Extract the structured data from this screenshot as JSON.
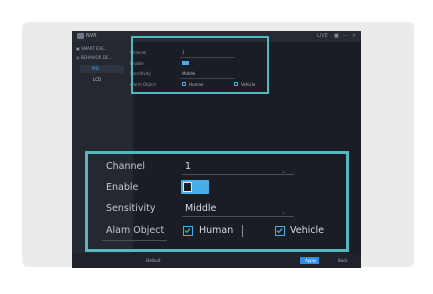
{
  "app": {
    "title": "NVR",
    "window_buttons": [
      "LIVE",
      "■",
      "—",
      "✕"
    ]
  },
  "sidebar": {
    "items": [
      {
        "label": "SMART EVE...",
        "icon": "camera-icon"
      },
      {
        "label": "BEHAVIOR DE...",
        "icon": "person-icon"
      }
    ],
    "selected_label": "PID",
    "sub_label": "LCD"
  },
  "small_form": {
    "channel_label": "Channel",
    "channel_value": "1",
    "enable_label": "Enable",
    "sensitivity_label": "Sensitivity",
    "sensitivity_value": "Middle",
    "alarm_object_label": "Alarm Object",
    "human_label": "Human",
    "vehicle_label": "Vehicle"
  },
  "footer": {
    "default_label": "Default",
    "save_label": "Apply",
    "back_label": "Back"
  },
  "zoom_form": {
    "channel_label": "Channel",
    "channel_value": "1",
    "enable_label": "Enable",
    "enable_on": true,
    "sensitivity_label": "Sensitivity",
    "sensitivity_value": "Middle",
    "alarm_object_label": "Alam Object",
    "human_label": "Human",
    "human_checked": true,
    "vehicle_label": "Vehicle",
    "vehicle_checked": true
  },
  "colors": {
    "highlight": "#53b8c4",
    "accent": "#49aee8",
    "background": "#1a1d23"
  }
}
